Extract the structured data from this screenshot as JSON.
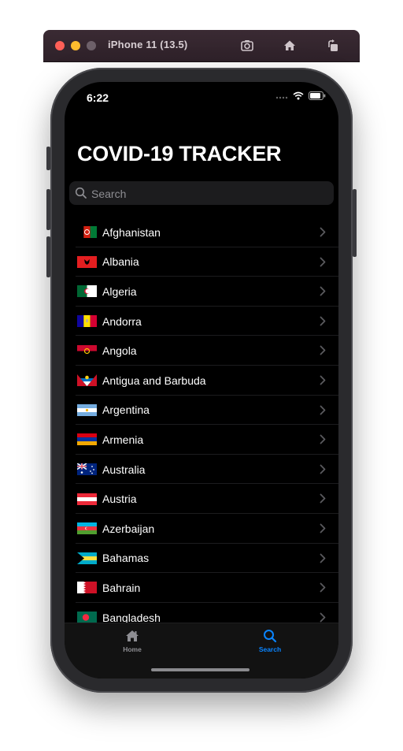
{
  "window": {
    "title": "iPhone 11 (13.5)"
  },
  "status_bar": {
    "time": "6:22"
  },
  "app": {
    "title": "COVID-19 TRACKER"
  },
  "search": {
    "placeholder": "Search"
  },
  "countries": [
    {
      "name": "Afghanistan",
      "flag": "afghanistan"
    },
    {
      "name": "Albania",
      "flag": "albania"
    },
    {
      "name": "Algeria",
      "flag": "algeria"
    },
    {
      "name": "Andorra",
      "flag": "andorra"
    },
    {
      "name": "Angola",
      "flag": "angola"
    },
    {
      "name": "Antigua and Barbuda",
      "flag": "antigua"
    },
    {
      "name": "Argentina",
      "flag": "argentina"
    },
    {
      "name": "Armenia",
      "flag": "armenia"
    },
    {
      "name": "Australia",
      "flag": "australia"
    },
    {
      "name": "Austria",
      "flag": "austria"
    },
    {
      "name": "Azerbaijan",
      "flag": "azerbaijan"
    },
    {
      "name": "Bahamas",
      "flag": "bahamas"
    },
    {
      "name": "Bahrain",
      "flag": "bahrain"
    },
    {
      "name": "Bangladesh",
      "flag": "bangladesh"
    }
  ],
  "tabs": [
    {
      "label": "Home",
      "icon": "house-icon",
      "active": false
    },
    {
      "label": "Search",
      "icon": "magnifier-icon",
      "active": true
    }
  ],
  "colors": {
    "accent": "#0a84ff",
    "inactive": "#8e8e93",
    "background": "#000000"
  }
}
